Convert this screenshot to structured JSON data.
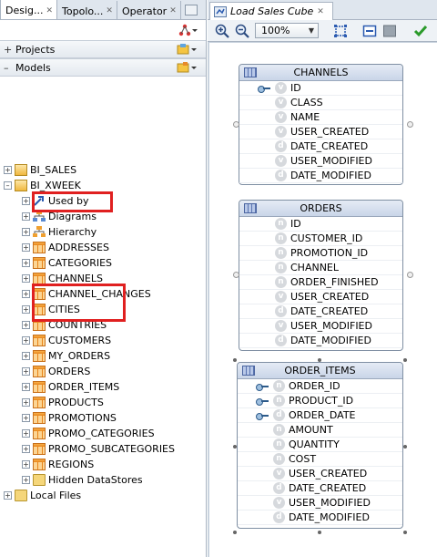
{
  "left_tabs": [
    {
      "label": "Desig..."
    },
    {
      "label": "Topolo..."
    },
    {
      "label": "Operator"
    }
  ],
  "accordions": {
    "projects": "Projects",
    "models": "Models",
    "local_files": "Local Files"
  },
  "tree": {
    "bi_sales": "BI_SALES",
    "bi_xweek": "BI_XWEEK",
    "used_by": "Used by",
    "diagrams": "Diagrams",
    "hierarchy": "Hierarchy",
    "tables": [
      "ADDRESSES",
      "CATEGORIES",
      "CHANNELS",
      "CHANNEL_CHANGES",
      "CITIES",
      "COUNTRIES",
      "CUSTOMERS",
      "MY_ORDERS",
      "ORDERS",
      "ORDER_ITEMS",
      "PRODUCTS",
      "PROMOTIONS",
      "PROMO_CATEGORIES",
      "PROMO_SUBCATEGORIES",
      "REGIONS"
    ],
    "hidden": "Hidden DataStores"
  },
  "editor": {
    "tab_label": "Load Sales Cube",
    "zoom": "100%"
  },
  "entities": {
    "channels": {
      "title": "CHANNELS",
      "attrs": [
        {
          "name": "ID",
          "type": "key"
        },
        {
          "name": "CLASS",
          "type": "v"
        },
        {
          "name": "NAME",
          "type": "v"
        },
        {
          "name": "USER_CREATED",
          "type": "v"
        },
        {
          "name": "DATE_CREATED",
          "type": "d"
        },
        {
          "name": "USER_MODIFIED",
          "type": "v"
        },
        {
          "name": "DATE_MODIFIED",
          "type": "d"
        }
      ]
    },
    "orders": {
      "title": "ORDERS",
      "attrs": [
        {
          "name": "ID",
          "type": "n"
        },
        {
          "name": "CUSTOMER_ID",
          "type": "n"
        },
        {
          "name": "PROMOTION_ID",
          "type": "n"
        },
        {
          "name": "CHANNEL",
          "type": "n"
        },
        {
          "name": "ORDER_FINISHED",
          "type": "n"
        },
        {
          "name": "USER_CREATED",
          "type": "v"
        },
        {
          "name": "DATE_CREATED",
          "type": "d"
        },
        {
          "name": "USER_MODIFIED",
          "type": "v"
        },
        {
          "name": "DATE_MODIFIED",
          "type": "d"
        }
      ]
    },
    "order_items": {
      "title": "ORDER_ITEMS",
      "attrs": [
        {
          "name": "ORDER_ID",
          "type": "key"
        },
        {
          "name": "PRODUCT_ID",
          "type": "key"
        },
        {
          "name": "ORDER_DATE",
          "type": "key"
        },
        {
          "name": "AMOUNT",
          "type": "n"
        },
        {
          "name": "QUANTITY",
          "type": "n"
        },
        {
          "name": "COST",
          "type": "n"
        },
        {
          "name": "USER_CREATED",
          "type": "v"
        },
        {
          "name": "DATE_CREATED",
          "type": "d"
        },
        {
          "name": "USER_MODIFIED",
          "type": "v"
        },
        {
          "name": "DATE_MODIFIED",
          "type": "d"
        }
      ]
    }
  }
}
